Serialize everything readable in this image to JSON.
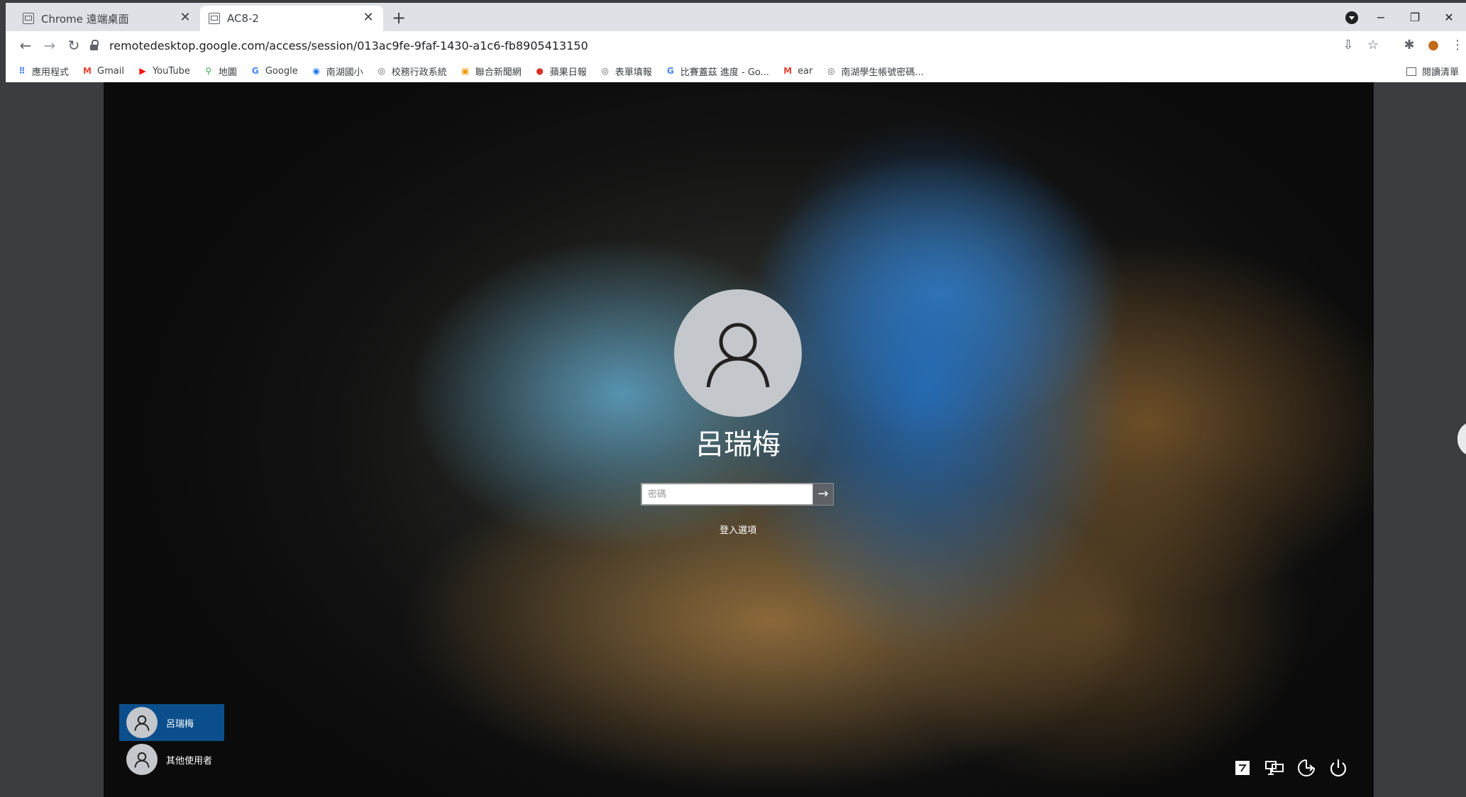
{
  "browser": {
    "tabs": [
      {
        "label": "Chrome 遠端桌面",
        "favicon": "remote-desktop-icon",
        "active": false
      },
      {
        "label": "AC8-2",
        "favicon": "remote-desktop-icon",
        "active": true
      }
    ],
    "new_tab": "+",
    "window_controls": [
      "−",
      "❐",
      "✕"
    ],
    "url": "remotedesktop.google.com/access/session/013ac9fe-9faf-1430-a1c6-fb8905413150"
  },
  "bookmarks": [
    {
      "label": "應用程式",
      "icon": "apps-grid-icon",
      "color": "#4285f4"
    },
    {
      "label": "Gmail",
      "icon": "gmail-icon",
      "color": "#ea4335"
    },
    {
      "label": "YouTube",
      "icon": "youtube-icon",
      "color": "#ff0000"
    },
    {
      "label": "地圖",
      "icon": "maps-pin-icon",
      "color": "#34a853"
    },
    {
      "label": "Google",
      "icon": "google-g-icon",
      "color": "#4285f4"
    },
    {
      "label": "南湖國小",
      "icon": "school-icon",
      "color": "#1a73e8"
    },
    {
      "label": "校務行政系統",
      "icon": "globe-icon",
      "color": "#5f6368"
    },
    {
      "label": "聯合新聞網",
      "icon": "udn-icon",
      "color": "#f29900"
    },
    {
      "label": "蘋果日報",
      "icon": "apple-daily-icon",
      "color": "#d93025"
    },
    {
      "label": "表單填報",
      "icon": "globe-icon",
      "color": "#5f6368"
    },
    {
      "label": "比賽蓋茲 進度 - Go...",
      "icon": "google-g-icon",
      "color": "#4285f4"
    },
    {
      "label": "ear",
      "icon": "gmail-icon",
      "color": "#ea4335"
    },
    {
      "label": "南湖學生帳號密碼...",
      "icon": "globe-icon",
      "color": "#5f6368"
    }
  ],
  "reading_list": "閱讀清單",
  "lockscreen": {
    "username": "呂瑞梅",
    "password_placeholder": "密碼",
    "submit_arrow": "→",
    "signin_options": "登入選項",
    "users": [
      {
        "label": "呂瑞梅",
        "selected": true
      },
      {
        "label": "其他使用者",
        "selected": false
      }
    ],
    "selected_user_color": "#0a4f8c"
  }
}
